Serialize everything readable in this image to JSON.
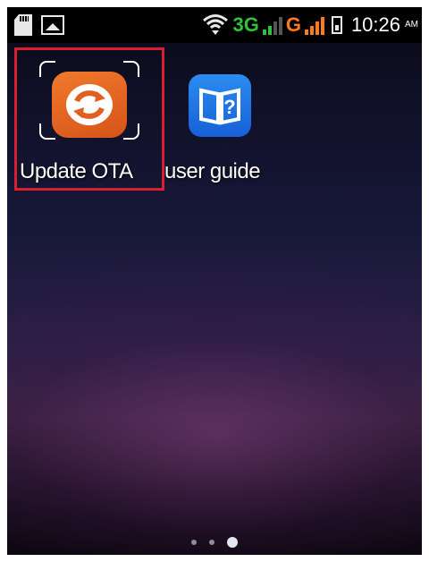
{
  "status_bar": {
    "network_3g": "3G",
    "network_g": "G",
    "time": "10:26",
    "am_pm": "AM",
    "icons": [
      "sd-card-icon",
      "image-icon",
      "wifi-icon",
      "signal-icon",
      "signal-icon",
      "battery-icon"
    ],
    "colors": {
      "network_3g": "#2ec43a",
      "network_g": "#ff7a1a"
    }
  },
  "home": {
    "apps": [
      {
        "label": "Update OTA",
        "icon": "refresh-icon",
        "icon_color": "#e8692a",
        "focused": true
      },
      {
        "label": "user guide",
        "icon": "book-question-icon",
        "icon_color": "#1e78e8",
        "focused": false
      }
    ],
    "focus_color": "#d42030"
  },
  "page_indicator": {
    "pages": 3,
    "current": 3
  }
}
